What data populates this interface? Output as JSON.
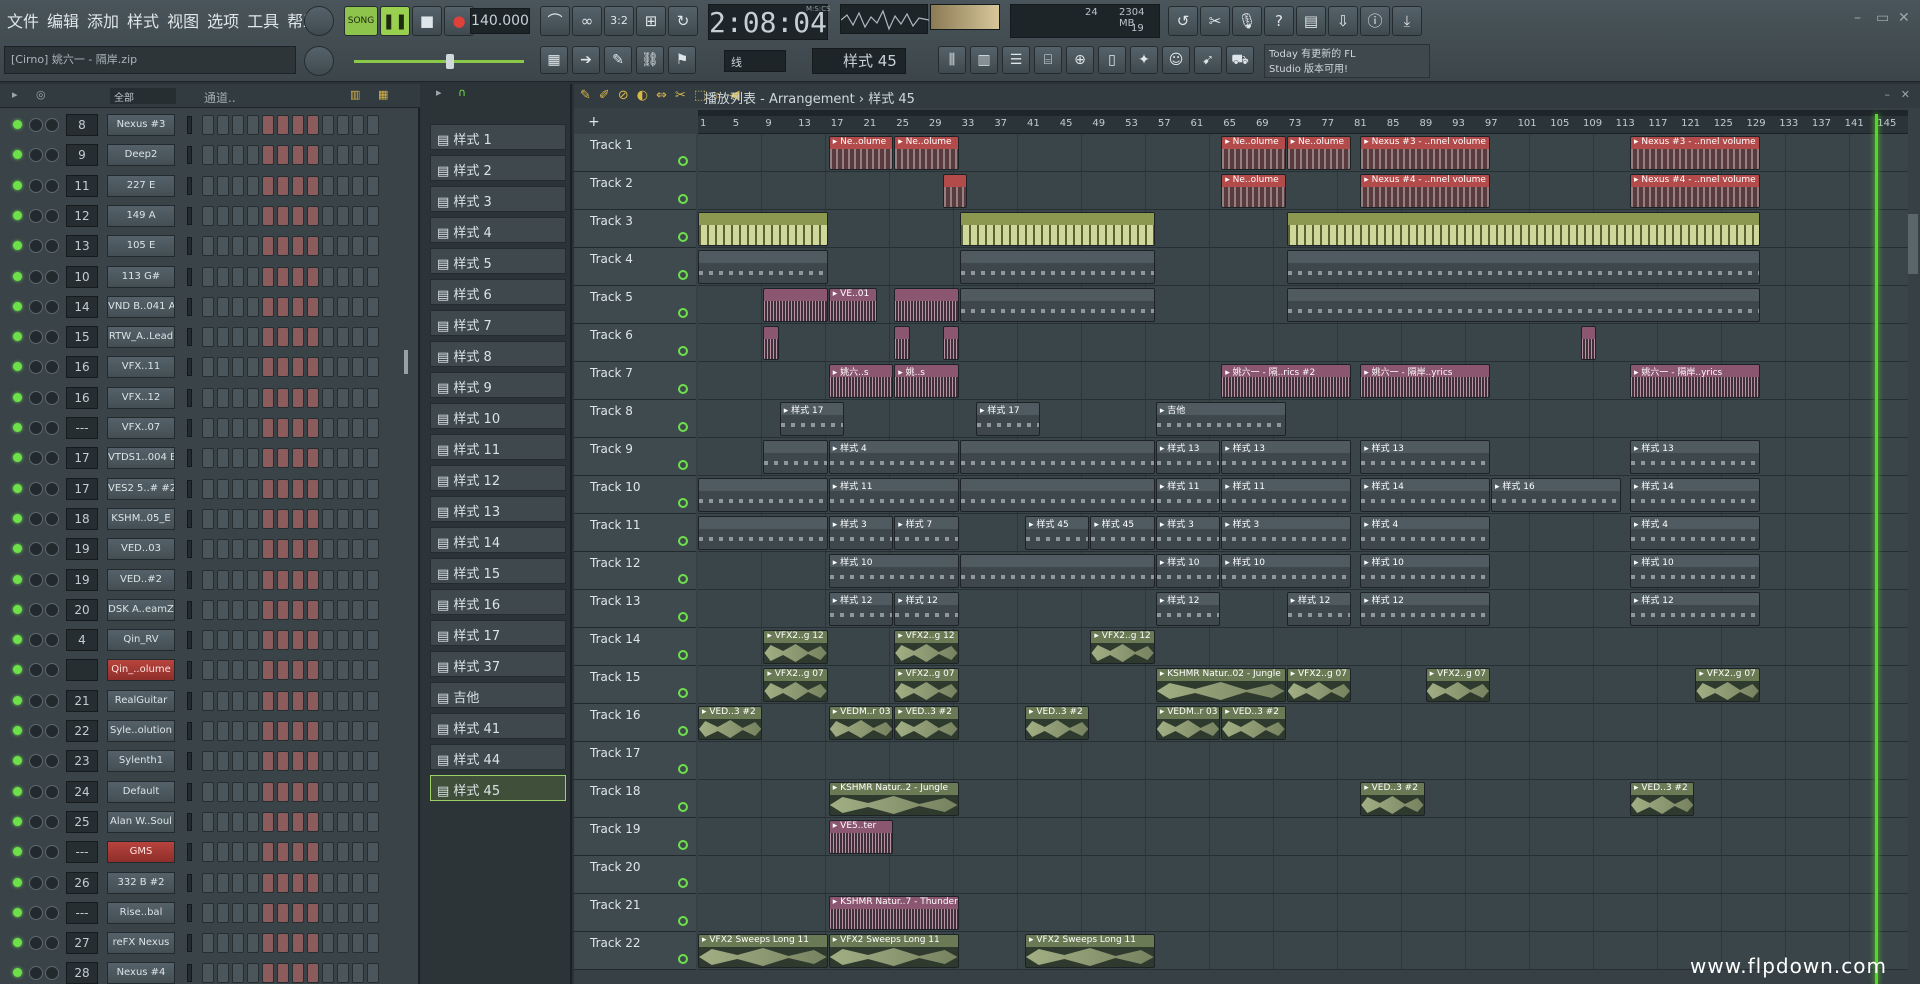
{
  "menu": [
    "文件",
    "编辑",
    "添加",
    "样式",
    "视图",
    "选项",
    "工具",
    "帮助"
  ],
  "transport": {
    "mode": "SONG",
    "tempo": "140.000",
    "time": "2:08:04",
    "time_unit": "M:S:CS",
    "cpu": "24",
    "mem": "2304 MB",
    "voices": "19"
  },
  "hint": "[Cirno] 姚六一 - 隔岸.zip",
  "snap": "线",
  "pattern_selector": "样式 45",
  "news": {
    "line1": "Today 有更新的 FL",
    "line2": "Studio 版本可用!"
  },
  "rack": {
    "filter": "全部",
    "group": "通道..",
    "channels": [
      {
        "num": "8",
        "name": "Nexus #3"
      },
      {
        "num": "9",
        "name": "Deep2"
      },
      {
        "num": "11",
        "name": "227 E"
      },
      {
        "num": "12",
        "name": "149 A"
      },
      {
        "num": "13",
        "name": "105 E"
      },
      {
        "num": "10",
        "name": "113 G#"
      },
      {
        "num": "14",
        "name": "VND B..041 A"
      },
      {
        "num": "15",
        "name": "RTW_A..Lead"
      },
      {
        "num": "16",
        "name": "VFX..11"
      },
      {
        "num": "16",
        "name": "VFX..12"
      },
      {
        "num": "---",
        "name": "VFX..07"
      },
      {
        "num": "17",
        "name": "VTDS1..004 B"
      },
      {
        "num": "17",
        "name": "VES2 5..# #2"
      },
      {
        "num": "18",
        "name": "KSHM..05_E"
      },
      {
        "num": "19",
        "name": "VED..03"
      },
      {
        "num": "19",
        "name": "VED..#2"
      },
      {
        "num": "20",
        "name": "DSK A..eamZ"
      },
      {
        "num": "4",
        "name": "Qin_RV"
      },
      {
        "num": "",
        "name": "Qin_..olume",
        "red": true
      },
      {
        "num": "21",
        "name": "RealGuitar"
      },
      {
        "num": "22",
        "name": "Syle..olution"
      },
      {
        "num": "23",
        "name": "Sylenth1"
      },
      {
        "num": "24",
        "name": "Default"
      },
      {
        "num": "25",
        "name": "Alan W..Soul"
      },
      {
        "num": "---",
        "name": "GMS",
        "red": true
      },
      {
        "num": "26",
        "name": "332 B #2"
      },
      {
        "num": "---",
        "name": "Rise..bal"
      },
      {
        "num": "27",
        "name": "reFX Nexus"
      },
      {
        "num": "28",
        "name": "Nexus #4"
      }
    ]
  },
  "patterns": [
    "样式 1",
    "样式 2",
    "样式 3",
    "样式 4",
    "样式 5",
    "样式 6",
    "样式 7",
    "样式 8",
    "样式 9",
    "样式 10",
    "样式 11",
    "样式 12",
    "样式 13",
    "样式 14",
    "样式 15",
    "样式 16",
    "样式 17",
    "样式 37",
    "吉他",
    "样式 41",
    "样式 44",
    "样式 45"
  ],
  "playlist": {
    "title": "播放列表 - Arrangement",
    "crumb": "样式 45",
    "bars": [
      "1",
      "5",
      "9",
      "13",
      "17",
      "21",
      "25",
      "29",
      "33",
      "37",
      "41",
      "45",
      "49",
      "53",
      "57",
      "61",
      "65",
      "69",
      "73",
      "77",
      "81",
      "85",
      "89",
      "93",
      "97",
      "101",
      "105",
      "109",
      "113",
      "117",
      "121",
      "125",
      "129",
      "133",
      "137",
      "141",
      "145"
    ],
    "tracks": [
      "Track 1",
      "Track 2",
      "Track 3",
      "Track 4",
      "Track 5",
      "Track 6",
      "Track 7",
      "Track 8",
      "Track 9",
      "Track 10",
      "Track 11",
      "Track 12",
      "Track 13",
      "Track 14",
      "Track 15",
      "Track 16",
      "Track 17",
      "Track 18",
      "Track 19",
      "Track 20",
      "Track 21",
      "Track 22"
    ],
    "clips": [
      {
        "t": 0,
        "s": 17,
        "l": 8,
        "k": "auto",
        "n": "Ne..olume"
      },
      {
        "t": 0,
        "s": 25,
        "l": 8,
        "k": "auto",
        "n": "Ne..olume"
      },
      {
        "t": 0,
        "s": 65,
        "l": 8,
        "k": "auto",
        "n": "Ne..olume"
      },
      {
        "t": 0,
        "s": 73,
        "l": 8,
        "k": "auto",
        "n": "Ne..olume"
      },
      {
        "t": 0,
        "s": 82,
        "l": 16,
        "k": "auto",
        "n": "Nexus #3 - ..nnel volume"
      },
      {
        "t": 0,
        "s": 115,
        "l": 16,
        "k": "auto",
        "n": "Nexus #3 - ..nnel volume"
      },
      {
        "t": 1,
        "s": 31,
        "l": 3,
        "k": "auto",
        "n": ""
      },
      {
        "t": 1,
        "s": 65,
        "l": 8,
        "k": "auto",
        "n": "Ne..olume"
      },
      {
        "t": 1,
        "s": 82,
        "l": 16,
        "k": "auto",
        "n": "Nexus #4 - ..nnel volume"
      },
      {
        "t": 1,
        "s": 115,
        "l": 16,
        "k": "auto",
        "n": "Nexus #4 - ..nnel volume"
      },
      {
        "t": 2,
        "s": 1,
        "l": 16,
        "k": "bright",
        "n": ""
      },
      {
        "t": 2,
        "s": 33,
        "l": 24,
        "k": "bright",
        "n": ""
      },
      {
        "t": 2,
        "s": 73,
        "l": 58,
        "k": "bright",
        "n": ""
      },
      {
        "t": 3,
        "s": 1,
        "l": 16,
        "k": "pat",
        "n": ""
      },
      {
        "t": 3,
        "s": 33,
        "l": 24,
        "k": "pat",
        "n": ""
      },
      {
        "t": 3,
        "s": 73,
        "l": 58,
        "k": "pat",
        "n": ""
      },
      {
        "t": 4,
        "s": 9,
        "l": 8,
        "k": "voc",
        "n": ""
      },
      {
        "t": 4,
        "s": 17,
        "l": 6,
        "k": "voc",
        "n": "VE..01"
      },
      {
        "t": 4,
        "s": 25,
        "l": 8,
        "k": "voc",
        "n": ""
      },
      {
        "t": 4,
        "s": 33,
        "l": 24,
        "k": "pat",
        "n": ""
      },
      {
        "t": 4,
        "s": 73,
        "l": 58,
        "k": "pat",
        "n": ""
      },
      {
        "t": 5,
        "s": 9,
        "l": 2,
        "k": "voc",
        "n": ""
      },
      {
        "t": 5,
        "s": 25,
        "l": 2,
        "k": "voc",
        "n": ""
      },
      {
        "t": 5,
        "s": 31,
        "l": 2,
        "k": "voc",
        "n": ""
      },
      {
        "t": 5,
        "s": 109,
        "l": 2,
        "k": "voc",
        "n": ""
      },
      {
        "t": 6,
        "s": 17,
        "l": 8,
        "k": "voc",
        "n": "姚六..s"
      },
      {
        "t": 6,
        "s": 25,
        "l": 8,
        "k": "voc",
        "n": "姚..s"
      },
      {
        "t": 6,
        "s": 65,
        "l": 16,
        "k": "voc",
        "n": "姚六一 - 隔..rics #2"
      },
      {
        "t": 6,
        "s": 82,
        "l": 16,
        "k": "voc",
        "n": "姚六一 - 隔岸..yrics"
      },
      {
        "t": 6,
        "s": 115,
        "l": 16,
        "k": "voc",
        "n": "姚六一 - 隔岸..yrics"
      },
      {
        "t": 7,
        "s": 11,
        "l": 8,
        "k": "pat",
        "n": "样式 17"
      },
      {
        "t": 7,
        "s": 35,
        "l": 8,
        "k": "pat",
        "n": "样式 17"
      },
      {
        "t": 7,
        "s": 57,
        "l": 16,
        "k": "pat",
        "n": "吉他"
      },
      {
        "t": 8,
        "s": 9,
        "l": 8,
        "k": "pat",
        "n": ""
      },
      {
        "t": 8,
        "s": 17,
        "l": 16,
        "k": "pat",
        "n": "样式 4"
      },
      {
        "t": 8,
        "s": 33,
        "l": 24,
        "k": "pat",
        "n": ""
      },
      {
        "t": 8,
        "s": 57,
        "l": 8,
        "k": "pat",
        "n": "样式 13"
      },
      {
        "t": 8,
        "s": 65,
        "l": 16,
        "k": "pat",
        "n": "样式 13"
      },
      {
        "t": 8,
        "s": 82,
        "l": 16,
        "k": "pat",
        "n": "样式 13"
      },
      {
        "t": 8,
        "s": 115,
        "l": 16,
        "k": "pat",
        "n": "样式 13"
      },
      {
        "t": 9,
        "s": 1,
        "l": 16,
        "k": "pat",
        "n": ""
      },
      {
        "t": 9,
        "s": 17,
        "l": 16,
        "k": "pat",
        "n": "样式 11"
      },
      {
        "t": 9,
        "s": 33,
        "l": 24,
        "k": "pat",
        "n": ""
      },
      {
        "t": 9,
        "s": 57,
        "l": 8,
        "k": "pat",
        "n": "样式 11"
      },
      {
        "t": 9,
        "s": 65,
        "l": 16,
        "k": "pat",
        "n": "样式 11"
      },
      {
        "t": 9,
        "s": 82,
        "l": 16,
        "k": "pat",
        "n": "样式 14"
      },
      {
        "t": 9,
        "s": 98,
        "l": 16,
        "k": "pat",
        "n": "样式 16"
      },
      {
        "t": 9,
        "s": 115,
        "l": 16,
        "k": "pat",
        "n": "样式 14"
      },
      {
        "t": 10,
        "s": 1,
        "l": 16,
        "k": "pat",
        "n": ""
      },
      {
        "t": 10,
        "s": 17,
        "l": 8,
        "k": "pat",
        "n": "样式 3"
      },
      {
        "t": 10,
        "s": 25,
        "l": 8,
        "k": "pat",
        "n": "样式 7"
      },
      {
        "t": 10,
        "s": 41,
        "l": 8,
        "k": "pat",
        "n": "样式 45"
      },
      {
        "t": 10,
        "s": 49,
        "l": 8,
        "k": "pat",
        "n": "样式 45"
      },
      {
        "t": 10,
        "s": 57,
        "l": 8,
        "k": "pat",
        "n": "样式 3"
      },
      {
        "t": 10,
        "s": 65,
        "l": 16,
        "k": "pat",
        "n": "样式 3"
      },
      {
        "t": 10,
        "s": 82,
        "l": 16,
        "k": "pat",
        "n": "样式 4"
      },
      {
        "t": 10,
        "s": 115,
        "l": 16,
        "k": "pat",
        "n": "样式 4"
      },
      {
        "t": 11,
        "s": 17,
        "l": 16,
        "k": "pat",
        "n": "样式 10"
      },
      {
        "t": 11,
        "s": 33,
        "l": 24,
        "k": "pat",
        "n": ""
      },
      {
        "t": 11,
        "s": 57,
        "l": 8,
        "k": "pat",
        "n": "样式 10"
      },
      {
        "t": 11,
        "s": 65,
        "l": 16,
        "k": "pat",
        "n": "样式 10"
      },
      {
        "t": 11,
        "s": 82,
        "l": 16,
        "k": "pat",
        "n": "样式 10"
      },
      {
        "t": 11,
        "s": 115,
        "l": 16,
        "k": "pat",
        "n": "样式 10"
      },
      {
        "t": 12,
        "s": 17,
        "l": 8,
        "k": "pat",
        "n": "样式 12"
      },
      {
        "t": 12,
        "s": 25,
        "l": 8,
        "k": "pat",
        "n": "样式 12"
      },
      {
        "t": 12,
        "s": 57,
        "l": 8,
        "k": "pat",
        "n": "样式 12"
      },
      {
        "t": 12,
        "s": 73,
        "l": 8,
        "k": "pat",
        "n": "样式 12"
      },
      {
        "t": 12,
        "s": 82,
        "l": 16,
        "k": "pat",
        "n": "样式 12"
      },
      {
        "t": 12,
        "s": 115,
        "l": 16,
        "k": "pat",
        "n": "样式 12"
      },
      {
        "t": 13,
        "s": 9,
        "l": 8,
        "k": "aud",
        "n": "VFX2..g 12"
      },
      {
        "t": 13,
        "s": 25,
        "l": 8,
        "k": "aud",
        "n": "VFX2..g 12"
      },
      {
        "t": 13,
        "s": 49,
        "l": 8,
        "k": "aud",
        "n": "VFX2..g 12"
      },
      {
        "t": 14,
        "s": 9,
        "l": 8,
        "k": "aud",
        "n": "VFX2..g 07"
      },
      {
        "t": 14,
        "s": 25,
        "l": 8,
        "k": "aud",
        "n": "VFX2..g 07"
      },
      {
        "t": 14,
        "s": 57,
        "l": 16,
        "k": "aud",
        "n": "KSHMR Natur..02 - Jungle"
      },
      {
        "t": 14,
        "s": 73,
        "l": 8,
        "k": "aud",
        "n": "VFX2..g 07"
      },
      {
        "t": 14,
        "s": 90,
        "l": 8,
        "k": "aud",
        "n": "VFX2..g 07"
      },
      {
        "t": 14,
        "s": 123,
        "l": 8,
        "k": "aud",
        "n": "VFX2..g 07"
      },
      {
        "t": 15,
        "s": 1,
        "l": 8,
        "k": "aud",
        "n": "VED..3 #2"
      },
      {
        "t": 15,
        "s": 17,
        "l": 8,
        "k": "aud",
        "n": "VEDM..r 03"
      },
      {
        "t": 15,
        "s": 25,
        "l": 8,
        "k": "aud",
        "n": "VED..3 #2"
      },
      {
        "t": 15,
        "s": 41,
        "l": 8,
        "k": "aud",
        "n": "VED..3 #2"
      },
      {
        "t": 15,
        "s": 57,
        "l": 8,
        "k": "aud",
        "n": "VEDM..r 03"
      },
      {
        "t": 15,
        "s": 65,
        "l": 8,
        "k": "aud",
        "n": "VED..3 #2"
      },
      {
        "t": 17,
        "s": 17,
        "l": 16,
        "k": "aud",
        "n": "KSHMR Natur..2 - Jungle"
      },
      {
        "t": 17,
        "s": 82,
        "l": 8,
        "k": "aud",
        "n": "VED..3 #2"
      },
      {
        "t": 17,
        "s": 115,
        "l": 8,
        "k": "aud",
        "n": "VED..3 #2"
      },
      {
        "t": 18,
        "s": 17,
        "l": 8,
        "k": "voc",
        "n": "VE5..ter"
      },
      {
        "t": 20,
        "s": 17,
        "l": 16,
        "k": "voc",
        "n": "KSHMR Natur..7 - Thunder"
      },
      {
        "t": 21,
        "s": 1,
        "l": 16,
        "k": "aud",
        "n": "VFX2 Sweeps Long 11"
      },
      {
        "t": 21,
        "s": 17,
        "l": 16,
        "k": "aud",
        "n": "VFX2 Sweeps Long 11"
      },
      {
        "t": 21,
        "s": 41,
        "l": 16,
        "k": "aud",
        "n": "VFX2 Sweeps Long 11"
      }
    ]
  },
  "watermark": "www.flpdown.com"
}
